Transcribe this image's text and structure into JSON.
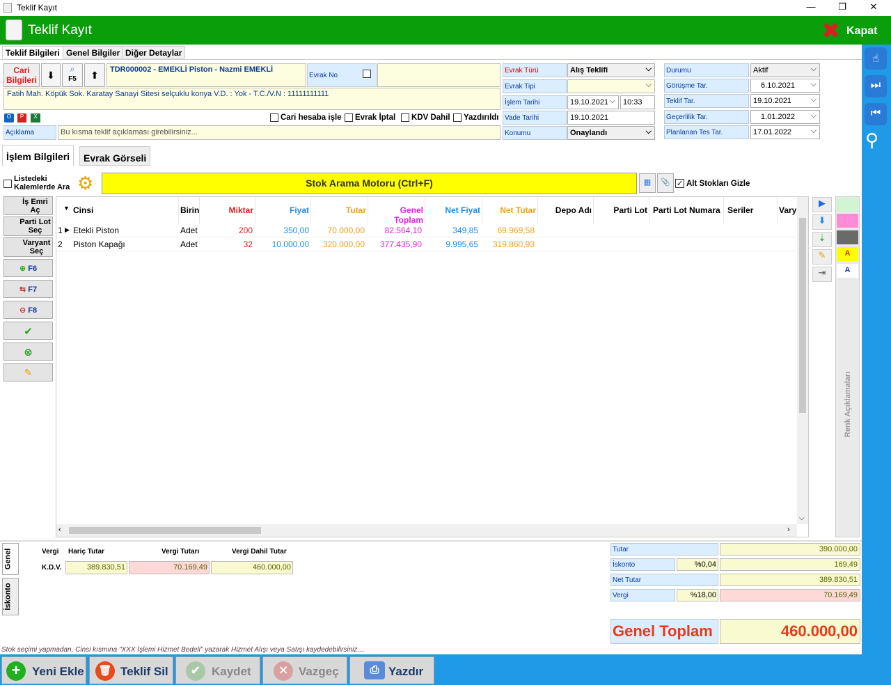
{
  "window": {
    "title": "Teklif Kayıt",
    "minimize": "—",
    "restore": "❐",
    "close": "✕"
  },
  "header": {
    "title": "Teklif Kayıt",
    "close_label": "Kapat"
  },
  "tabs": [
    "Teklif Bilgileri",
    "Genel Bilgiler",
    "Diğer Detaylar"
  ],
  "cari": {
    "button": "Cari Bilgileri",
    "f5": "F5",
    "name": "TDR000002 - EMEKLİ Piston - Nazmi EMEKLİ",
    "address": "Fatih Mah. Köpük Sok.  Karatay Sanayi Sitesi selçuklu konya V.D. :  Yok - T.C./V.N :  11111111111",
    "evrak_no_label": "Evrak No"
  },
  "checks": {
    "cari_hesaba": "Cari hesaba işle",
    "evrak_iptal": "Evrak İptal",
    "kdv_dahil": "KDV Dahil",
    "yazdirildi": "Yazdırıldı"
  },
  "aciklama": {
    "label": "Açıklama",
    "placeholder": "Bu kısma teklif açıklaması girebilirsiniz..."
  },
  "mid": {
    "evrak_turu_label": "Evrak Türü",
    "evrak_turu": "Alış Teklifi",
    "evrak_tipi_label": "Evrak Tipi",
    "islem_tarihi_label": "İşlem Tarihi",
    "islem_tarihi": "19.10.2021",
    "islem_saat": "10:33",
    "vade_label": "Vade Tarihi",
    "vade": "19.10.2021",
    "konum_label": "Konumu",
    "konum": "Onaylandı"
  },
  "right": {
    "durum_label": "Durumu",
    "durum": "Aktif",
    "gorusme_label": "Görüşme Tar.",
    "gorusme": "6.10.2021",
    "teklif_label": "Teklif Tar.",
    "teklif": "19.10.2021",
    "gecerlilik_label": "Geçerlilik Tar.",
    "gecerlilik": "1.01.2022",
    "planlanan_label": "Planlanan Tes Tar.",
    "planlanan": "17.01.2022"
  },
  "subtabs": [
    "İşlem Bilgileri",
    "Evrak Görseli"
  ],
  "search": {
    "listede": "Listedeki Kalemlerde Ara",
    "engine": "Stok Arama Motoru (Ctrl+F)",
    "alt_stok": "Alt Stokları Gizle"
  },
  "side": {
    "is_emri": "İş Emri Aç",
    "parti_lot": "Parti Lot Seç",
    "varyant": "Varyant Seç",
    "f6": "F6",
    "f7": "F7",
    "f8": "F8"
  },
  "columns": [
    "Cinsi",
    "Birin",
    "Miktar",
    "Fiyat",
    "Tutar",
    "Genel Toplam",
    "Net Fiyat",
    "Net Tutar",
    "Depo Adı",
    "Parti Lot",
    "Parti Lot Numara",
    "Seriler",
    "Vary"
  ],
  "rows": [
    {
      "no": "1",
      "cinsi": "Etekli Piston",
      "birim": "Adet",
      "miktar": "200",
      "fiyat": "350,00",
      "tutar": "70.000,00",
      "genel": "82.564,10",
      "netfiyat": "349,85",
      "nettutar": "69.969,58"
    },
    {
      "no": "2",
      "cinsi": "Piston Kapağı",
      "birim": "Adet",
      "miktar": "32",
      "fiyat": "10.000,00",
      "tutar": "320.000,00",
      "genel": "377.435,90",
      "netfiyat": "9.995,65",
      "nettutar": "319.860,93"
    }
  ],
  "renk": "Renk Açıklamaları",
  "tax": {
    "tab_genel": "Genel",
    "tab_iskonto": "İskonto",
    "h_vergi": "Vergi",
    "h_haric": "Hariç Tutar",
    "h_tutar": "Vergi Tutarı",
    "h_dahil": "Vergi Dahil Tutar",
    "row_label": "K.D.V.",
    "haric": "389.830,51",
    "tutar": "70.169,49",
    "dahil": "460.000,00"
  },
  "summary": {
    "tutar_label": "Tutar",
    "tutar": "390.000,00",
    "iskonto_label": "İskonto",
    "iskonto_pct": "%0,04",
    "iskonto": "169,49",
    "net_label": "Net Tutar",
    "net": "389.830,51",
    "vergi_label": "Vergi",
    "vergi_pct": "%18,00",
    "vergi": "70.169,49",
    "genel_label": "Genel Toplam",
    "genel": "460.000,00"
  },
  "hint": "Stok seçimi yapmadan, Cinsi kısmına \"XXX İşlemi Hizmet Bedeli\" yazarak Hizmet Alışı veya Satışı kaydedebilirsiniz....",
  "bottom": {
    "yeni": "Yeni Ekle",
    "sil": "Teklif Sil",
    "kaydet": "Kaydet",
    "vazgec": "Vazgeç",
    "yazdir": "Yazdır"
  }
}
